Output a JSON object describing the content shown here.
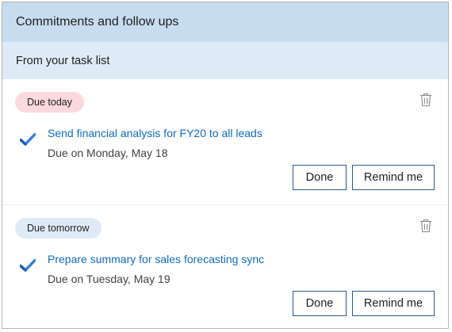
{
  "header": {
    "title": "Commitments and follow ups"
  },
  "subheader": {
    "title": "From your task list"
  },
  "tasks": [
    {
      "badge": "Due today",
      "badge_color": "#fbd9dc",
      "title": "Send financial analysis for FY20 to all leads",
      "due": "Due on Monday, May 18",
      "done_label": "Done",
      "remind_label": "Remind me",
      "icon": "trash-icon"
    },
    {
      "badge": "Due tomorrow",
      "badge_color": "#deebf7",
      "title": "Prepare summary for sales forecasting sync",
      "due": "Due on Tuesday, May 19",
      "done_label": "Done",
      "remind_label": "Remind me",
      "icon": "trash-icon"
    }
  ],
  "colors": {
    "header_bg": "#c7dcef",
    "subheader_bg": "#deebf7",
    "link": "#0f6cbd",
    "button_border": "#2b5b8a"
  }
}
